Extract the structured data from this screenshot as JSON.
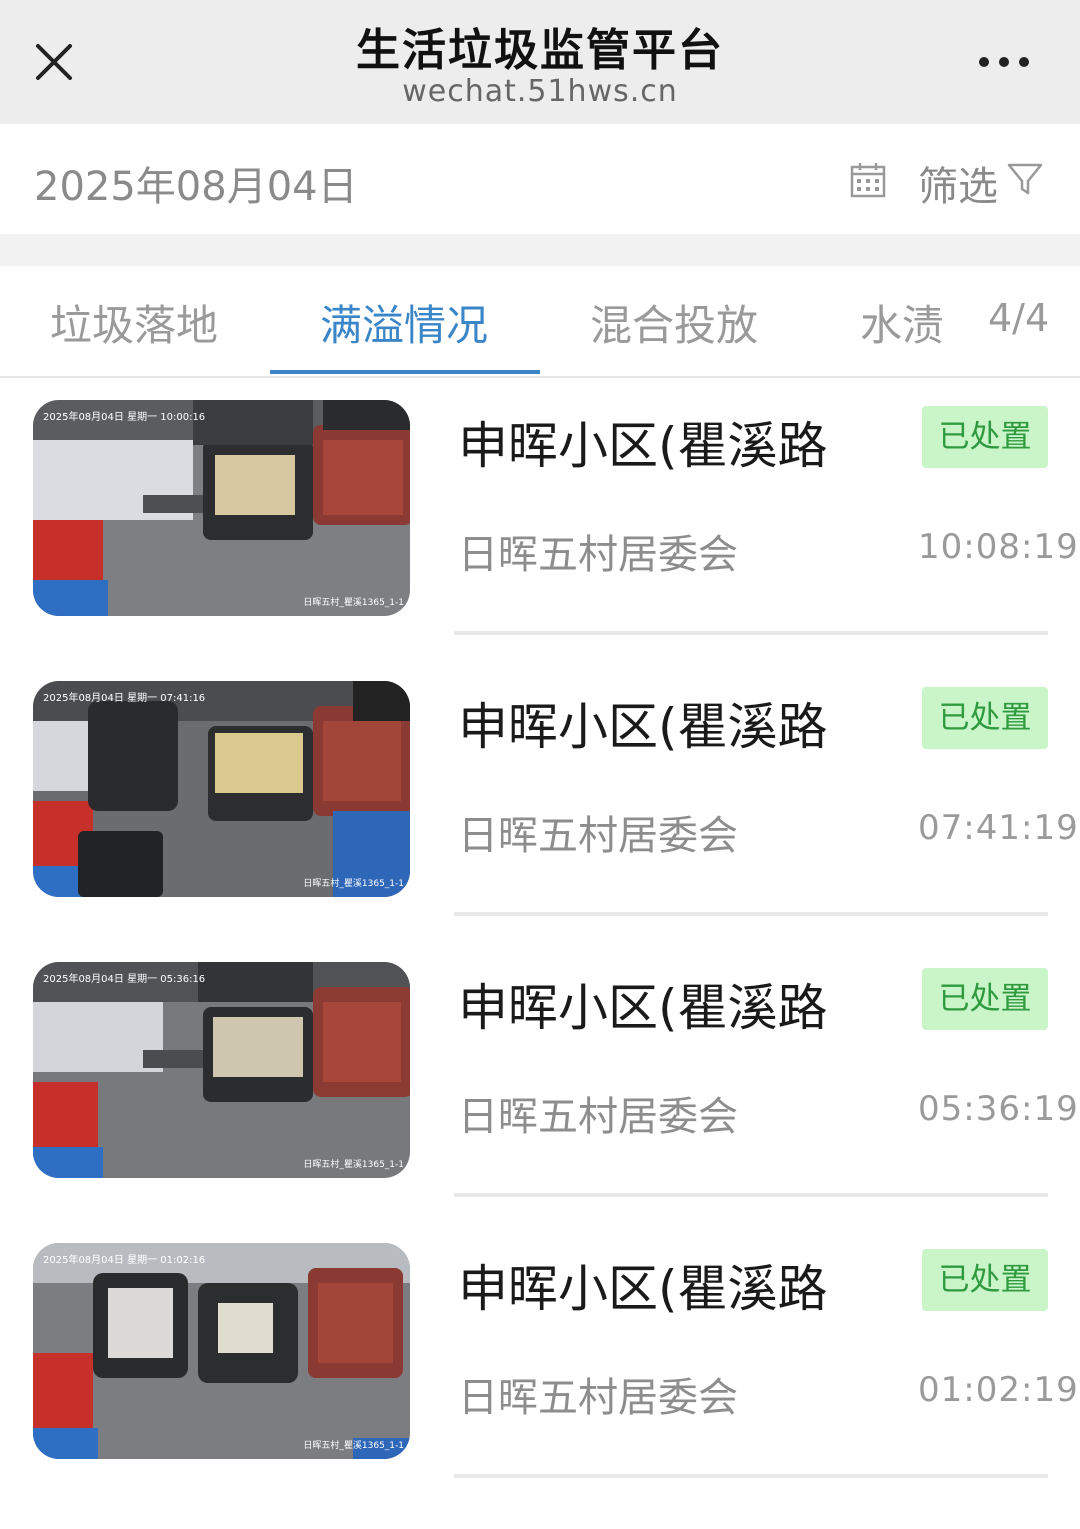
{
  "header": {
    "title": "生活垃圾监管平台",
    "url": "wechat.51hws.cn",
    "close_icon": "close-icon",
    "more_icon": "more-horizontal-icon"
  },
  "toolbar": {
    "date": "2025年08月04日",
    "calendar_icon": "calendar-icon",
    "filter_label": "筛选",
    "filter_icon": "funnel-icon"
  },
  "tabs": {
    "items": [
      {
        "label": "垃圾落地",
        "active": false
      },
      {
        "label": "满溢情况",
        "active": true
      },
      {
        "label": "混合投放",
        "active": false
      },
      {
        "label": "水渍",
        "active": false
      }
    ],
    "counter": "4/4",
    "accent_color": "#3a86c8"
  },
  "records": [
    {
      "title": "申晖小区(瞿溪路",
      "status": "已处置",
      "org": "日晖五村居委会",
      "time": "10:08:19",
      "cam_timestamp": "2025年08月04日  星期一  10:00:16",
      "cam_location": "日晖五村_瞿溪1365_1-1"
    },
    {
      "title": "申晖小区(瞿溪路",
      "status": "已处置",
      "org": "日晖五村居委会",
      "time": "07:41:19",
      "cam_timestamp": "2025年08月04日  星期一  07:41:16",
      "cam_location": "日晖五村_瞿溪1365_1-1"
    },
    {
      "title": "申晖小区(瞿溪路",
      "status": "已处置",
      "org": "日晖五村居委会",
      "time": "05:36:19",
      "cam_timestamp": "2025年08月04日  星期一  05:36:16",
      "cam_location": "日晖五村_瞿溪1365_1-1"
    },
    {
      "title": "申晖小区(瞿溪路",
      "status": "已处置",
      "org": "日晖五村居委会",
      "time": "01:02:19",
      "cam_timestamp": "2025年08月04日  星期一  01:02:16",
      "cam_location": "日晖五村_瞿溪1365_1-1"
    }
  ],
  "colors": {
    "status_bg": "#c9f5c9",
    "status_text": "#2f9a3f",
    "header_bg": "#ededed"
  }
}
